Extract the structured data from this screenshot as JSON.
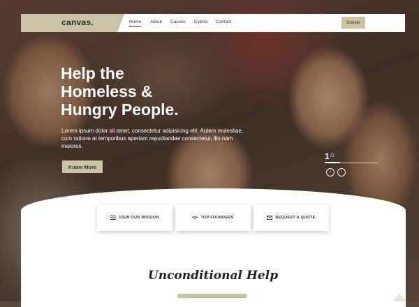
{
  "nav": {
    "logo": "canvas.",
    "items": [
      {
        "label": "Home",
        "active": true
      },
      {
        "label": "About",
        "active": false
      },
      {
        "label": "Causes",
        "active": false
      },
      {
        "label": "Events",
        "active": false
      },
      {
        "label": "Contact",
        "active": false
      }
    ],
    "donate_label": "Donate"
  },
  "hero": {
    "headline_lines": [
      "Help the",
      "Homeless &",
      "Hungry People."
    ],
    "paragraph": "Lorem ipsum dolor sit amet, consectetur adipisicing elit. Autem molestiae, cum ratione at temporibus aperiam repudiandae consectetur, illo nam maiores.",
    "cta_label": "Know More",
    "slider": {
      "current": "1",
      "total": "/2"
    }
  },
  "cards": [
    {
      "label": "VIEW OUR MISSION",
      "icon": "list-icon"
    },
    {
      "label": "TOP FOUNDERS",
      "icon": "umbrella-icon"
    },
    {
      "label": "REQUEST A QUOTE",
      "icon": "envelope-icon"
    }
  ],
  "section": {
    "title": "Unconditional Help"
  },
  "colors": {
    "accent": "#cbc3a3",
    "text_dark": "#333333",
    "white": "#ffffff"
  }
}
